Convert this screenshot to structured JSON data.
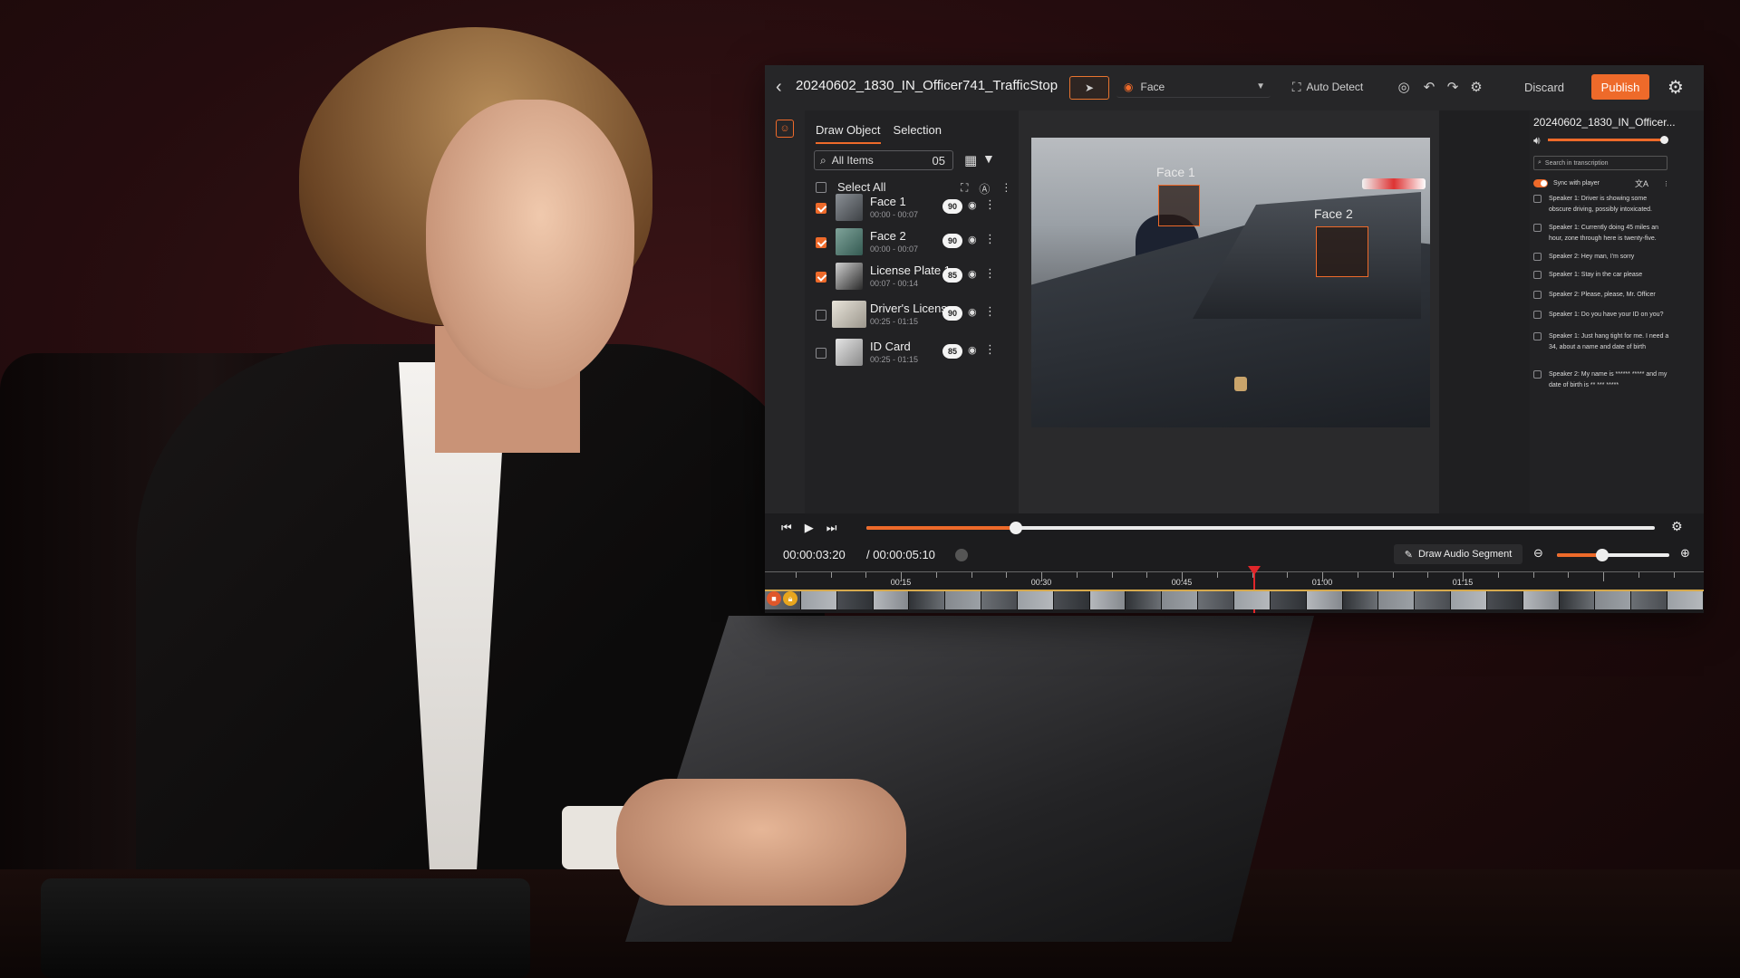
{
  "window": {
    "title": "20240602_1830_IN_Officer741_TrafficStop",
    "back_icon": "chevron-left-icon",
    "face_dropdown_value": "Face",
    "auto_detect_label": "Auto Detect",
    "discard_label": "Discard",
    "publish_label": "Publish",
    "accent_color": "#ee6a2a"
  },
  "left_panel": {
    "tabs": [
      {
        "label": "Draw Object",
        "active": true
      },
      {
        "label": "Selection",
        "active": false
      }
    ],
    "search_label": "All Items",
    "item_count": "05",
    "select_all_label": "Select All",
    "items": [
      {
        "name": "Face 1",
        "time": "00:00 - 00:07",
        "score": "90",
        "checked": true
      },
      {
        "name": "Face 2",
        "time": "00:00 - 00:07",
        "score": "90",
        "checked": true
      },
      {
        "name": "License Plate 1",
        "time": "00:07 - 00:14",
        "score": "85",
        "checked": true
      },
      {
        "name": "Driver's License",
        "time": "00:25 - 01:15",
        "score": "90",
        "checked": false
      },
      {
        "name": "ID Card",
        "time": "00:25 - 01:15",
        "score": "85",
        "checked": false
      }
    ]
  },
  "viewer": {
    "boxes": [
      {
        "label": "Face 1"
      },
      {
        "label": "Face 2"
      }
    ]
  },
  "right_panel": {
    "title": "20240602_1830_IN_Officer...",
    "search_placeholder": "Search in transcription",
    "sync_label": "Sync with player",
    "transcript": [
      "Speaker 1: Driver is showing some obscure driving, possibly intoxicated.",
      "Speaker 1: Currently doing 45 miles an hour, zone through here is twenty-five.",
      "Speaker 2: Hey man, I'm sorry",
      "Speaker 1: Stay in the car please",
      "Speaker 2: Please, please, Mr. Officer",
      "Speaker 1: Do you have your ID on you?",
      "Speaker 1: Just hang tight for me. I need a 34, about a name and date of birth",
      "Speaker 2: My name is ****** ***** and my date of birth is ** *** *****"
    ]
  },
  "player": {
    "current_time": "00:00:03:20",
    "total_time": "/ 00:00:05:10",
    "progress_fraction": 0.19,
    "draw_audio_label": "Draw Audio Segment",
    "zoom_fraction": 0.4,
    "ruler_labels": [
      "00:15",
      "00:30",
      "00:45",
      "01:00",
      "01:15"
    ]
  }
}
